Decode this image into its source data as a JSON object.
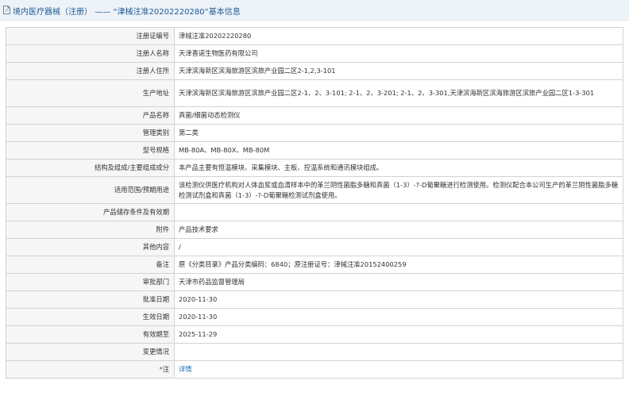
{
  "header": {
    "prefix": "境内医疗器械（注册）",
    "separator": "——",
    "title": "“津械注准20202220280”基本信息"
  },
  "rows": [
    {
      "label": "注册证编号",
      "value": "津械注准20202220280"
    },
    {
      "label": "注册人名称",
      "value": "天津喜诺生物医药有限公司"
    },
    {
      "label": "注册人住所",
      "value": "天津滨海新区滨海旅游区滨旅产业园二区2-1,2,3-101"
    },
    {
      "label": "生产地址",
      "value": "天津滨海新区滨海旅游区滨旅产业园二区2-1、2、3-101; 2-1、2、3-201; 2-1、2、3-301,天津滨海新区滨海旅游区滨旅产业园二区1-3-301"
    },
    {
      "label": "产品名称",
      "value": "真菌/细菌动态检测仪"
    },
    {
      "label": "管理类别",
      "value": "第二类"
    },
    {
      "label": "型号规格",
      "value": "MB-80A、MB-80X、MB-80M"
    },
    {
      "label": "结构及组成/主要组成成分",
      "value": "本产品主要有恒温模块、采集模块、主板、控温系统和通讯模块组成。"
    },
    {
      "label": "适用范围/预期用途",
      "value": "该检测仪供医疗机构对人体血浆或血清样本中的革兰阴性菌脂多糖和真菌（1-3）-?-D葡聚糖进行检测使用。检测仪配合本公司生产的革兰阴性菌脂多糖检测试剂盒和真菌（1-3）-?-D葡聚糖检测试剂盒使用。"
    },
    {
      "label": "产品储存条件及有效期",
      "value": ""
    },
    {
      "label": "附件",
      "value": "产品技术要求"
    },
    {
      "label": "其他内容",
      "value": "/"
    },
    {
      "label": "备注",
      "value": "原《分类目录》产品分类编码：6840；原注册证号：津械注准20152400259"
    },
    {
      "label": "审批部门",
      "value": "天津市药品监督管理局"
    },
    {
      "label": "批准日期",
      "value": "2020-11-30"
    },
    {
      "label": "生效日期",
      "value": "2020-11-30"
    },
    {
      "label": "有效期至",
      "value": "2025-11-29"
    },
    {
      "label": "变更情况",
      "value": ""
    },
    {
      "label": "注",
      "value": "详情"
    }
  ],
  "colors": {
    "link": "#1a6fb8",
    "header_bg": "#eef3f8",
    "label_bg": "#f6f6f6",
    "border": "#d3d3d3"
  },
  "icons": {
    "header": "document-icon"
  }
}
